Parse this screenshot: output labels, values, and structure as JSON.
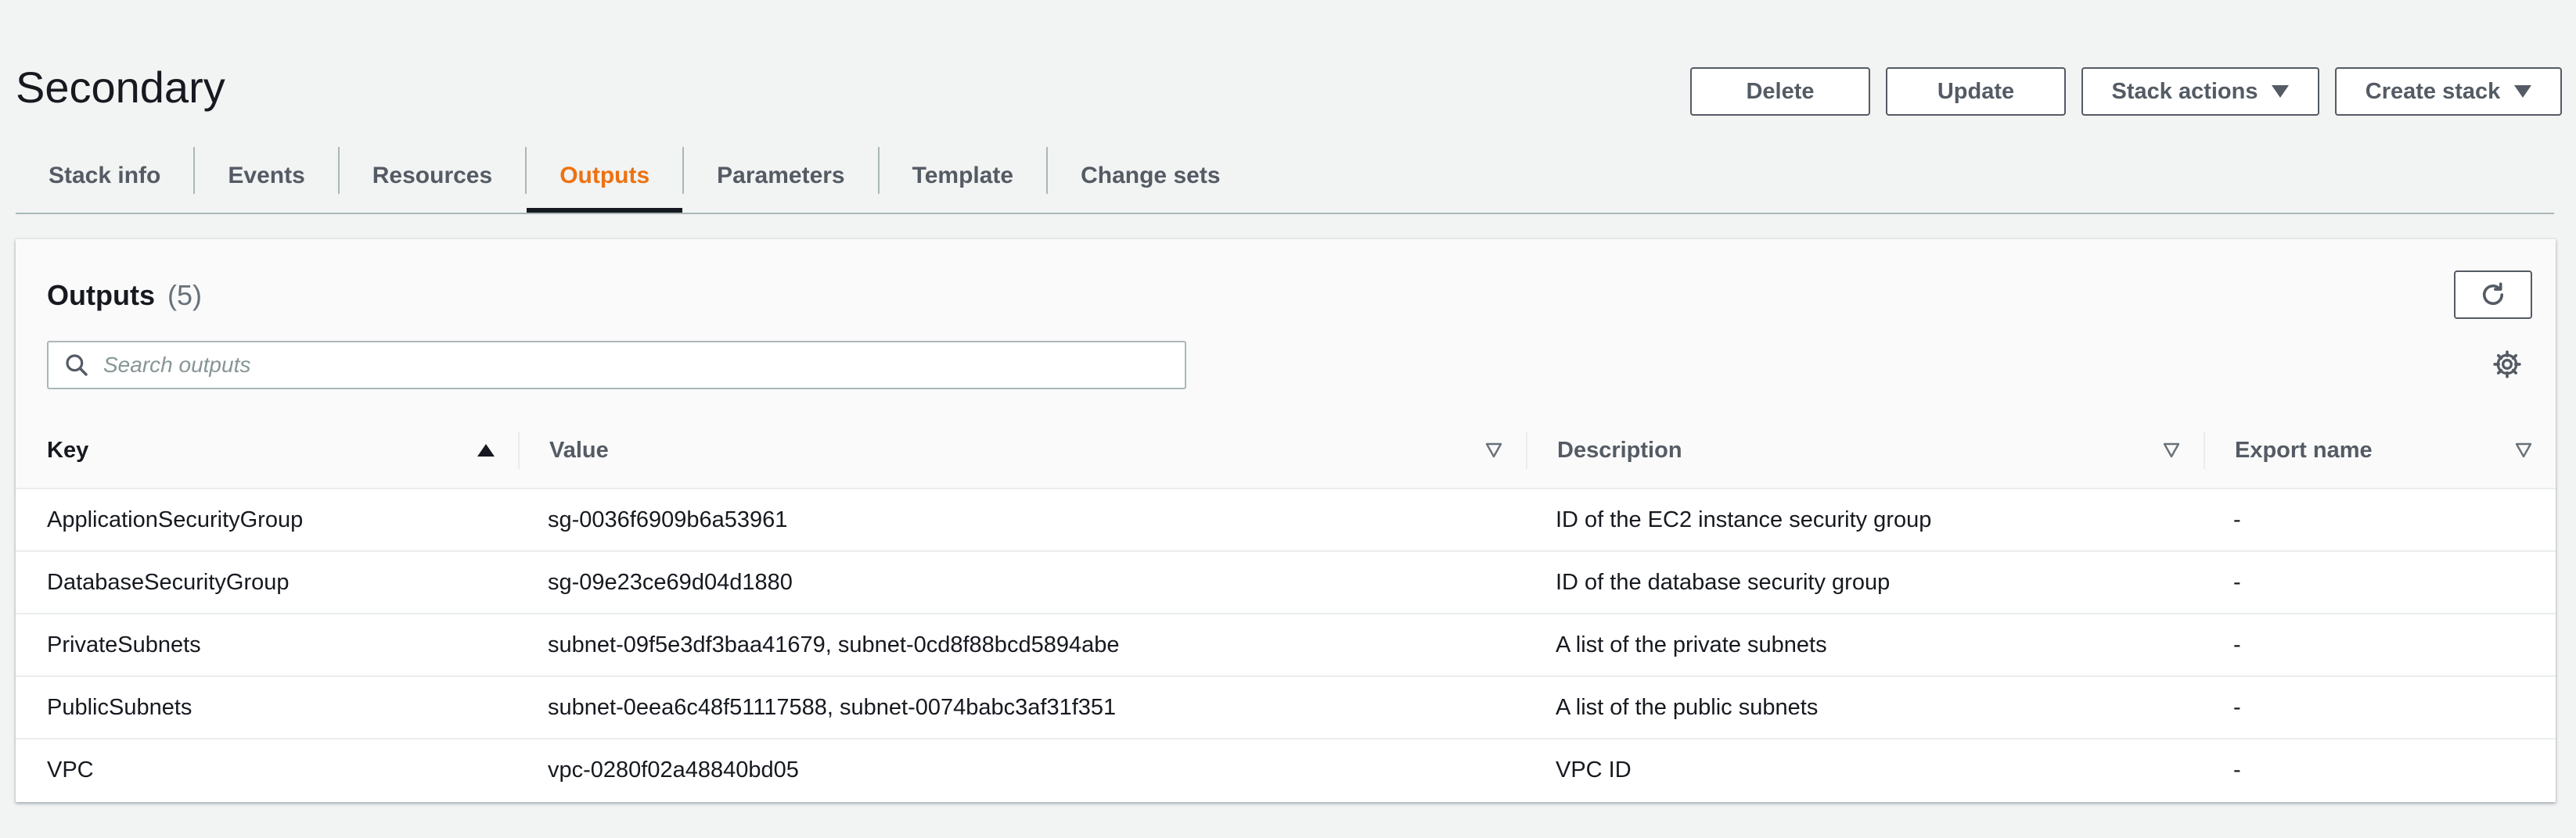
{
  "page": {
    "title": "Secondary"
  },
  "actions": {
    "delete": "Delete",
    "update": "Update",
    "stack_actions": "Stack actions",
    "create_stack": "Create stack"
  },
  "tabs": [
    {
      "label": "Stack info"
    },
    {
      "label": "Events"
    },
    {
      "label": "Resources"
    },
    {
      "label": "Outputs",
      "active": true
    },
    {
      "label": "Parameters"
    },
    {
      "label": "Template"
    },
    {
      "label": "Change sets"
    }
  ],
  "outputs": {
    "title": "Outputs",
    "count": "(5)",
    "search_placeholder": "Search outputs",
    "columns": {
      "key": "Key",
      "value": "Value",
      "description": "Description",
      "export_name": "Export name"
    },
    "sorted_column": "key",
    "sort_direction": "ascending",
    "rows": [
      {
        "key": "ApplicationSecurityGroup",
        "value": "sg-0036f6909b6a53961",
        "description": "ID of the EC2 instance security group",
        "export_name": "-"
      },
      {
        "key": "DatabaseSecurityGroup",
        "value": "sg-09e23ce69d04d1880",
        "description": "ID of the database security group",
        "export_name": "-"
      },
      {
        "key": "PrivateSubnets",
        "value": "subnet-09f5e3df3baa41679, subnet-0cd8f88bcd5894abe",
        "description": "A list of the private subnets",
        "export_name": "-"
      },
      {
        "key": "PublicSubnets",
        "value": "subnet-0eea6c48f51117588, subnet-0074babc3af31f351",
        "description": "A list of the public subnets",
        "export_name": "-"
      },
      {
        "key": "VPC",
        "value": "vpc-0280f02a48840bd05",
        "description": "VPC ID",
        "export_name": "-"
      }
    ]
  },
  "icons": {
    "refresh": "refresh-icon",
    "search": "search-icon",
    "settings": "gear-icon",
    "sort": "sort-ascending-icon",
    "filter": "caret-down-outline-icon"
  },
  "colors": {
    "accent": "#ec7211",
    "text": "#16191f",
    "secondary_text": "#545b64",
    "border": "#aab7b8",
    "background": "#f2f3f3"
  }
}
